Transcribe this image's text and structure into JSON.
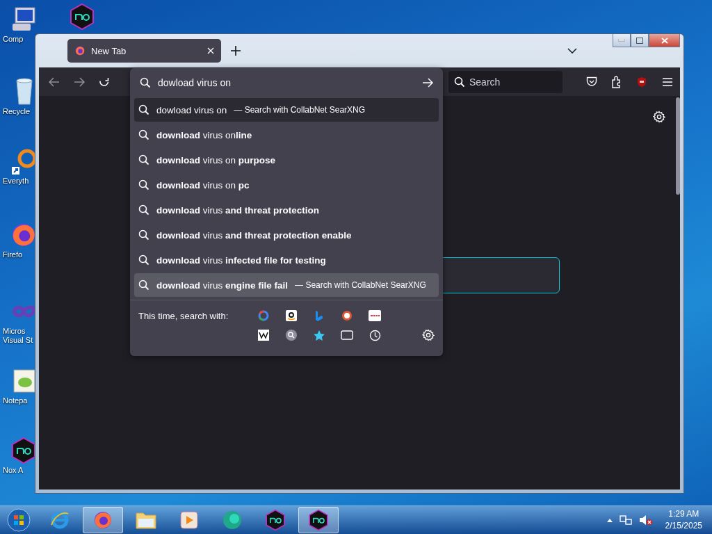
{
  "desktop_icons": [
    {
      "kind": "computer",
      "label": "Comp"
    },
    {
      "kind": "nox"
    },
    {
      "kind": "recycle",
      "label": "Recycle"
    },
    {
      "kind": "everything",
      "label": "Everyth"
    },
    {
      "kind": "firefox",
      "label": "Firefo"
    },
    {
      "kind": "studio",
      "label": "Micros Visual St"
    },
    {
      "kind": "notepad",
      "label": "Notepa"
    },
    {
      "kind": "nox",
      "label": "Nox A"
    }
  ],
  "browser": {
    "tabs": [
      {
        "label": "New Tab",
        "selected": true
      }
    ],
    "url_field": {
      "value": "dowload virus on"
    },
    "search_field": {
      "placeholder": "Search"
    },
    "suggestions": [
      {
        "text": "dowload virus on",
        "action": "— Search with CollabNet SearXNG",
        "selected": true,
        "hovered": false
      },
      {
        "text": "**download** virus on**line**",
        "selected": false,
        "hovered": false
      },
      {
        "text": "**download** virus on **purpose**",
        "selected": false,
        "hovered": false
      },
      {
        "text": "**download** virus on **pc**",
        "selected": false,
        "hovered": false
      },
      {
        "text": "**download** virus **and threat protection**",
        "selected": false,
        "hovered": false
      },
      {
        "text": "**download** virus **and threat protection enable**",
        "selected": false,
        "hovered": false
      },
      {
        "text": "**download** virus **infected file for testing**",
        "selected": false,
        "hovered": false
      },
      {
        "text": "**download** virus **engine file fail**",
        "action": "— Search with CollabNet SearXNG",
        "selected": false,
        "hovered": true
      }
    ],
    "one_off_label": "This time, search with:"
  },
  "taskbar": {
    "buttons": [
      {
        "kind": "ie",
        "active": false
      },
      {
        "kind": "firefox",
        "active": true
      },
      {
        "kind": "explorer",
        "active": false
      },
      {
        "kind": "media",
        "active": false
      },
      {
        "kind": "orb",
        "active": false
      },
      {
        "kind": "nox",
        "active": false
      },
      {
        "kind": "nox",
        "active": true
      }
    ],
    "time": "1:29 AM",
    "date": "2/15/2025"
  }
}
